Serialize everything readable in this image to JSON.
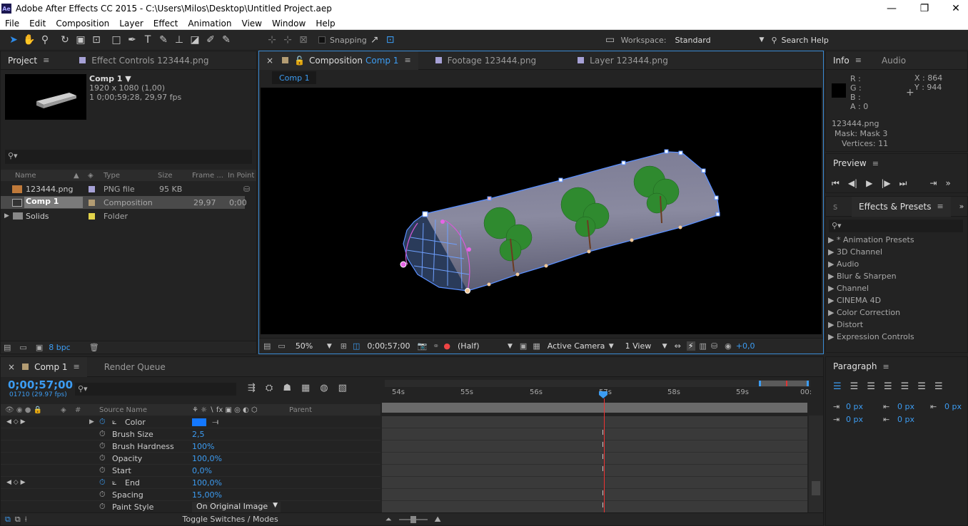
{
  "app": {
    "icon": "Ae",
    "title": "Adobe After Effects CC 2015 - C:\\Users\\Milos\\Desktop\\Untitled Project.aep",
    "minimize": "—",
    "maximize": "❐",
    "close": "✕"
  },
  "menu": [
    "File",
    "Edit",
    "Composition",
    "Layer",
    "Effect",
    "Animation",
    "View",
    "Window",
    "Help"
  ],
  "toolbar": {
    "snapping": "Snapping",
    "workspace_label": "Workspace:",
    "workspace_value": "Standard",
    "search_help": "Search Help"
  },
  "project": {
    "tab": "Project",
    "effect_controls_tab": "Effect Controls 123444.png",
    "comp_name": "Comp 1 ▼",
    "comp_res": "1920 x 1080 (1,00)",
    "comp_dur": "1 0;00;59;28, 29,97 fps",
    "search_placeholder": "",
    "columns": [
      "Name",
      "Type",
      "Size",
      "Frame ...",
      "In Point"
    ],
    "items": [
      {
        "name": "123444.png",
        "type": "PNG file",
        "size": "95 KB",
        "frame": "",
        "inpoint": "",
        "color": "#a6a1d6",
        "icon": "image-icon"
      },
      {
        "name": "Comp 1",
        "type": "Composition",
        "size": "",
        "frame": "29,97",
        "inpoint": "0;00",
        "color": "#b39c73",
        "icon": "composition-icon"
      },
      {
        "name": "Solids",
        "type": "Folder",
        "size": "",
        "frame": "",
        "inpoint": "",
        "color": "#e2d34a",
        "icon": "folder-icon"
      }
    ],
    "bpc": "8 bpc"
  },
  "viewer": {
    "tab_comp_label": "Composition",
    "tab_comp_name": "Comp 1",
    "tab_footage": "Footage 123444.png",
    "tab_layer": "Layer 123444.png",
    "breadcrumb": "Comp 1",
    "zoom": "50%",
    "timecode": "0;00;57;00",
    "resolution": "(Half)",
    "camera": "Active Camera",
    "views": "1 View",
    "exposure": "+0,0"
  },
  "info": {
    "tab": "Info",
    "audio_tab": "Audio",
    "r": "R :",
    "g": "G :",
    "b": "B :",
    "a": "A : 0",
    "x": "X : 864",
    "y": "Y : 944",
    "layer": "123444.png",
    "mask": "Mask: Mask 3",
    "vertices": "Vertices: 11"
  },
  "preview": {
    "tab": "Preview"
  },
  "effects": {
    "tab": "Effects & Presets",
    "items": [
      "▶ * Animation Presets",
      "▶ 3D Channel",
      "▶ Audio",
      "▶ Blur & Sharpen",
      "▶ Channel",
      "▶ CINEMA 4D",
      "▶ Color Correction",
      "▶ Distort",
      "▶ Expression Controls"
    ]
  },
  "paragraph": {
    "tab": "Paragraph",
    "indent_values": [
      "0 px",
      "0 px",
      "0 px",
      "0 px",
      "0 px"
    ]
  },
  "timeline": {
    "tab": "Comp 1",
    "render_queue": "Render Queue",
    "timecode": "0;00;57;00",
    "frames": "01710 (29.97 fps)",
    "header_source": "Source Name",
    "header_parent": "Parent",
    "header_num": "#",
    "ruler": [
      "54s",
      "55s",
      "56s",
      "57s",
      "58s",
      "59s",
      "00:"
    ],
    "props": [
      {
        "name": "Color",
        "value": "",
        "color": "#1478ff",
        "keyed": true,
        "graph": true
      },
      {
        "name": "Brush Size",
        "value": "2,5"
      },
      {
        "name": "Brush Hardness",
        "value": "100%"
      },
      {
        "name": "Opacity",
        "value": "100,0%"
      },
      {
        "name": "Start",
        "value": "0,0%"
      },
      {
        "name": "End",
        "value": "100,0%",
        "keyed": true,
        "graph": true
      },
      {
        "name": "Spacing",
        "value": "15,00%"
      },
      {
        "name": "Paint Style",
        "value": "On Original Image"
      }
    ],
    "toggle": "Toggle Switches / Modes"
  }
}
